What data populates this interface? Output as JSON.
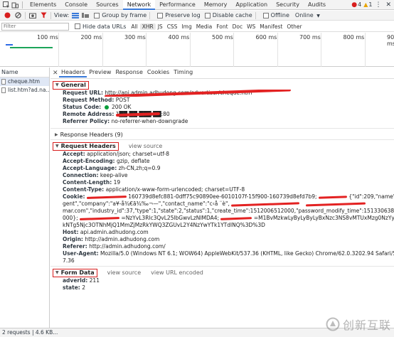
{
  "devtools": {
    "tabs": [
      "Elements",
      "Console",
      "Sources",
      "Network",
      "Performance",
      "Memory",
      "Application",
      "Security",
      "Audits"
    ],
    "active_tab": "Network",
    "error_count": "4",
    "warning_count": "1",
    "menu_glyph": "⋮",
    "close_glyph": "✕"
  },
  "toolbar": {
    "view_label": "View:",
    "group_by_frame": "Group by frame",
    "preserve_log": "Preserve log",
    "disable_cache": "Disable cache",
    "offline": "Offline",
    "throttle": "Online"
  },
  "filterbar": {
    "placeholder": "Filter",
    "hide_data_urls": "Hide data URLs",
    "types": [
      "All",
      "XHR",
      "JS",
      "CSS",
      "Img",
      "Media",
      "Font",
      "Doc",
      "WS",
      "Manifest",
      "Other"
    ],
    "active_type": "XHR"
  },
  "timeline": {
    "ticks": [
      "100 ms",
      "200 ms",
      "300 ms",
      "400 ms",
      "500 ms",
      "600 ms",
      "700 ms",
      "800 ms",
      "900 ms"
    ]
  },
  "requests": {
    "header": "Name",
    "items": [
      {
        "name": "cheque.htm",
        "selected": true
      },
      {
        "name": "list.htm?ad.na...",
        "selected": false
      }
    ]
  },
  "detail_tabs": {
    "close": "✕",
    "items": [
      "Headers",
      "Preview",
      "Response",
      "Cookies",
      "Timing"
    ],
    "active": "Headers"
  },
  "general": {
    "title": "General",
    "request_url_label": "Request URL:",
    "request_url": "http://api.admin.adhudong.com/advertiser/cheque.htm",
    "request_method_label": "Request Method:",
    "request_method": "POST",
    "status_code_label": "Status Code:",
    "status_code": "200 OK",
    "remote_address_label": "Remote Address:",
    "remote_address": "1██.██.███.██:80",
    "referrer_policy_label": "Referrer Policy:",
    "referrer_policy": "no-referrer-when-downgrade"
  },
  "response_headers": {
    "title": "Response Headers (9)"
  },
  "request_headers": {
    "title": "Request Headers",
    "view_source": "view source",
    "lines": [
      {
        "key": "Accept:",
        "value": "application/json; charset=utf-8"
      },
      {
        "key": "Accept-Encoding:",
        "value": "gzip, deflate"
      },
      {
        "key": "Accept-Language:",
        "value": "zh-CN,zh;q=0.9"
      },
      {
        "key": "Connection:",
        "value": "keep-alive"
      },
      {
        "key": "Content-Length:",
        "value": "19"
      },
      {
        "key": "Content-Type:",
        "value": "application/x-www-form-urlencoded; charset=UTF-8"
      }
    ],
    "cookie_label": "Cookie:",
    "cookie_line1": "160739d8efc881-0dff75c90890ee-6010107f-15f900-160739d8efd7b9;",
    "cookie_line1b": "{\"id\":209,\"name\":\"wlq_a",
    "cookie_line2a": "gent\",\"company\":\"a¥-å¾€ã¾‰¬­—\",\"contact_name\":\"c‹å ¨è\",",
    "cookie_line3b": "mar.com\",\"industry_id\":37,\"type\":1,\"state\":2,\"status\":1,\"create_time\":1512006512000,\"password_modify_time\":1513306386",
    "cookie_line4a": "000};",
    "cookie_line4b": "=NzYvL3Rlc3QvL25lbGwvLzNlMDA4;",
    "cookie_line4c": "=M1BvMzkwLyByLyByLyBxNzc3NS8vMTUxMzg0NzYyOTc4Mi8vYmE1NWQ5MzR",
    "cookie_line5": "kNTg5Njc3OTNhMjQ1MmZjMzRkYWQ3ZGUvL2Y4NzYwYTk1YTdlNQ%3D%3D",
    "host_label": "Host:",
    "host": "api.admin.adhudong.com",
    "origin_label": "Origin:",
    "origin": "http://admin.adhudong.com",
    "referer_label": "Referer:",
    "referer": "http://admin.adhudong.com/",
    "ua_label": "User-Agent:",
    "ua_line1": "Mozilla/5.0 (Windows NT 6.1; WOW64) AppleWebKit/537.36 (KHTML, like Gecko) Chrome/62.0.3202.94 Safari/53",
    "ua_line2": "7.36"
  },
  "form_data": {
    "title": "Form Data",
    "view_source": "view source",
    "view_url_encoded": "view URL encoded",
    "fields": [
      {
        "key": "adverId:",
        "value": "211"
      },
      {
        "key": "state:",
        "value": "2"
      }
    ]
  },
  "statusbar": {
    "text": "2 requests | 4.6 KB..."
  },
  "watermark": {
    "text": "创新互联"
  },
  "colors": {
    "accent": "#3879d9",
    "redact": "#e32222",
    "status_ok": "#0a9e3b",
    "error": "#d81e1e"
  }
}
